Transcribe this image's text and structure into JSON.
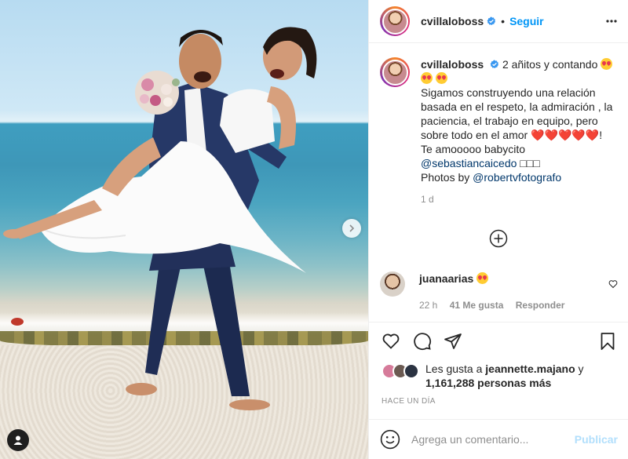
{
  "header": {
    "username": "cvillaloboss",
    "separator": "•",
    "follow_label": "Seguir",
    "verified_icon": "verified-badge-icon",
    "more_icon": "more-options-icon"
  },
  "caption": {
    "username": "cvillaloboss",
    "line1": "2 añitos y contando",
    "body": "Sigamos construyendo una relación basada en el respeto, la admiración , la paciencia, el trabajo en equipo, pero sobre todo en el amor",
    "hearts": "❤️❤️❤️❤️❤️",
    "exclaim": "!",
    "line2": "Te amooooo babycito",
    "mention1": "@sebastiancaicedo",
    "mention1_suffix": "□□□",
    "photos_by": "Photos by",
    "mention2": "@robertvfotografo",
    "time": "1 d"
  },
  "comment": {
    "username": "juanaarias",
    "time": "22 h",
    "likes": "41 Me gusta",
    "reply": "Responder"
  },
  "likes": {
    "prefix": "Les gusta a",
    "user": "jeannette.majano",
    "and": "y",
    "count": "1,161,288 personas más"
  },
  "posted": "HACE UN DÍA",
  "add_comment": {
    "placeholder": "Agrega un comentario...",
    "publish": "Publicar"
  },
  "colors": {
    "accent": "#0095f6",
    "link": "#00376b",
    "muted": "#8e8e8e",
    "heart": "#ed4956",
    "publish_disabled": "#b2dffc"
  }
}
